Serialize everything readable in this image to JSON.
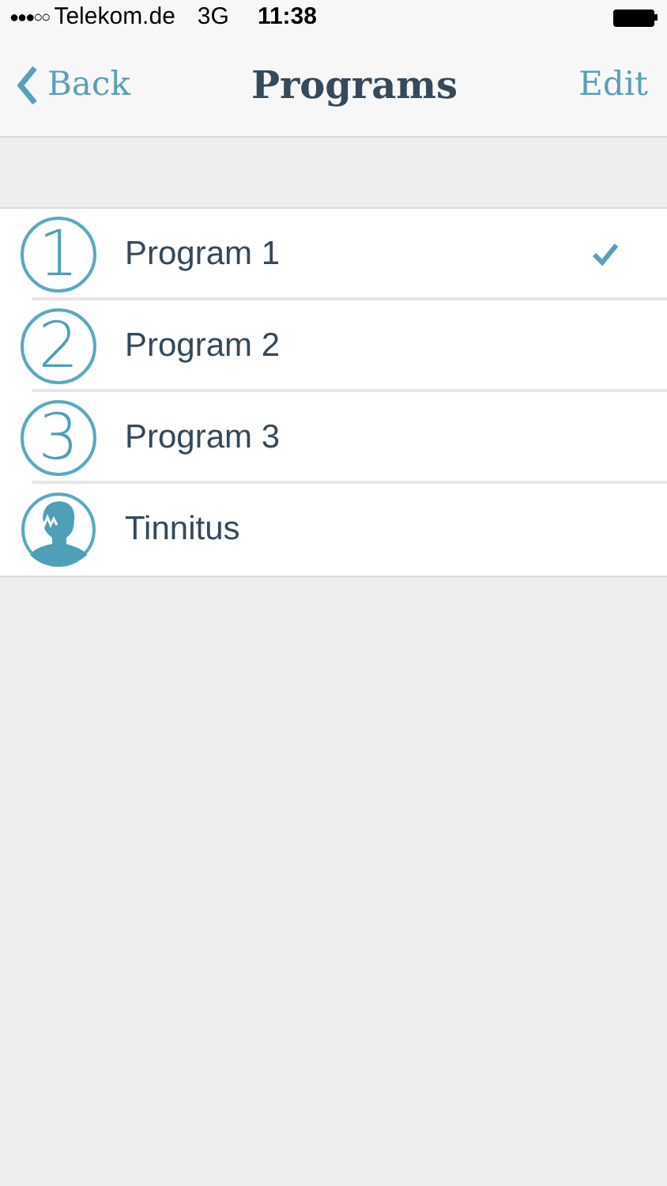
{
  "status_bar": {
    "signal": "●●●○○",
    "carrier": "Telekom.de",
    "network": "3G",
    "time": "11:38"
  },
  "nav": {
    "back": "Back",
    "title": "Programs",
    "action": "Edit"
  },
  "programs": [
    {
      "kind": "number",
      "number": "1",
      "label": "Program 1",
      "selected": true
    },
    {
      "kind": "number",
      "number": "2",
      "label": "Program 2",
      "selected": false
    },
    {
      "kind": "number",
      "number": "3",
      "label": "Program 3",
      "selected": false
    },
    {
      "kind": "tinnitus",
      "label": "Tinnitus",
      "selected": false
    }
  ]
}
